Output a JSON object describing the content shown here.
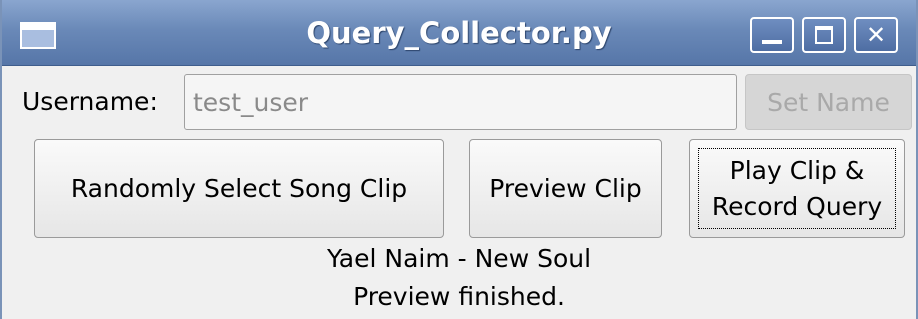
{
  "window": {
    "title": "Query_Collector.py",
    "controls": {
      "minimize": "minimize-icon",
      "maximize": "maximize-icon",
      "close": "close-icon"
    }
  },
  "form": {
    "username_label": "Username:",
    "username_placeholder": "test_user",
    "set_name_label": "Set Name"
  },
  "actions": {
    "random_label": "Randomly Select Song Clip",
    "preview_label": "Preview Clip",
    "play_label": "Play Clip &\nRecord Query"
  },
  "status": {
    "song": "Yael Naim - New Soul",
    "message": "Preview finished."
  },
  "colors": {
    "titlebar": "#6a89b8",
    "window_bg": "#f0f0f0"
  }
}
